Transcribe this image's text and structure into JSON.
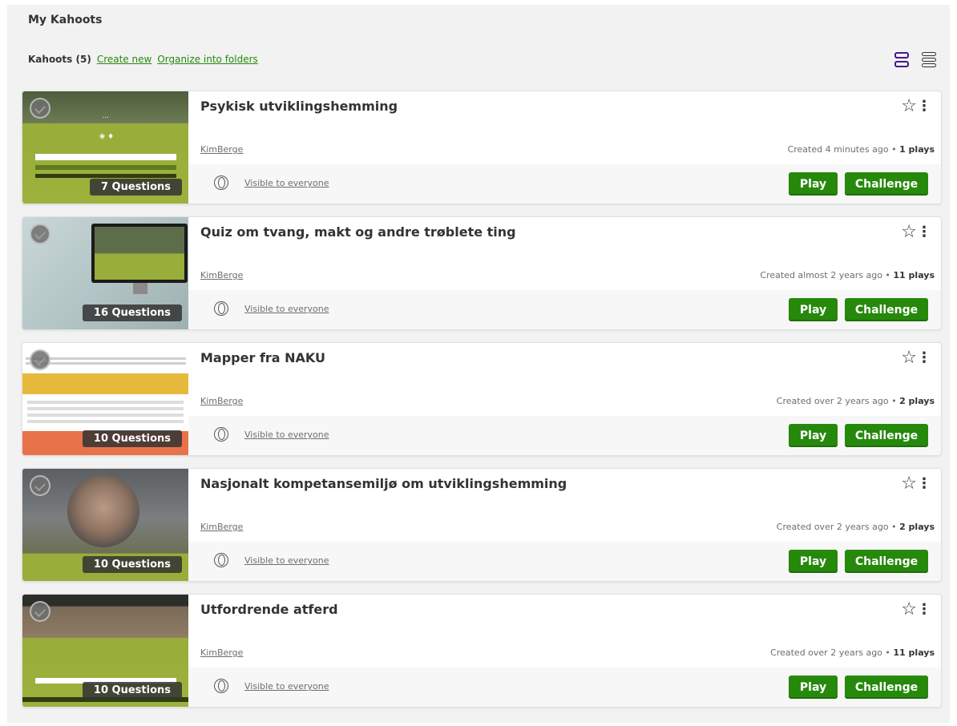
{
  "page": {
    "title": "My Kahoots"
  },
  "toolbar": {
    "count_label": "Kahoots (5)",
    "create_new": "Create new",
    "organize": "Organize into folders"
  },
  "colors": {
    "accent_green": "#26890c",
    "purple": "#46178f",
    "text": "#333333"
  },
  "icons": {
    "view_grid": "grid-view-icon",
    "view_list": "list-view-icon",
    "favorite": "star-outline-icon",
    "menu": "more-vertical-icon",
    "visibility": "globe-icon"
  },
  "labels": {
    "play": "Play",
    "challenge": "Challenge",
    "visibility": "Visible to everyone"
  },
  "kahoots": [
    {
      "title": "Psykisk utviklingshemming",
      "author": "KimBerge",
      "created": "Created 4 minutes ago",
      "plays": "1 plays",
      "questions": "7 Questions"
    },
    {
      "title": "Quiz om tvang, makt og andre trøblete ting",
      "author": "KimBerge",
      "created": "Created almost 2 years ago",
      "plays": "11 plays",
      "questions": "16 Questions"
    },
    {
      "title": "Mapper fra NAKU",
      "author": "KimBerge",
      "created": "Created over 2 years ago",
      "plays": "2 plays",
      "questions": "10 Questions"
    },
    {
      "title": "Nasjonalt kompetansemiljø om utviklingshemming",
      "author": "KimBerge",
      "created": "Created over 2 years ago",
      "plays": "2 plays",
      "questions": "10 Questions"
    },
    {
      "title": "Utfordrende atferd",
      "author": "KimBerge",
      "created": "Created over 2 years ago",
      "plays": "11 plays",
      "questions": "10 Questions"
    }
  ]
}
